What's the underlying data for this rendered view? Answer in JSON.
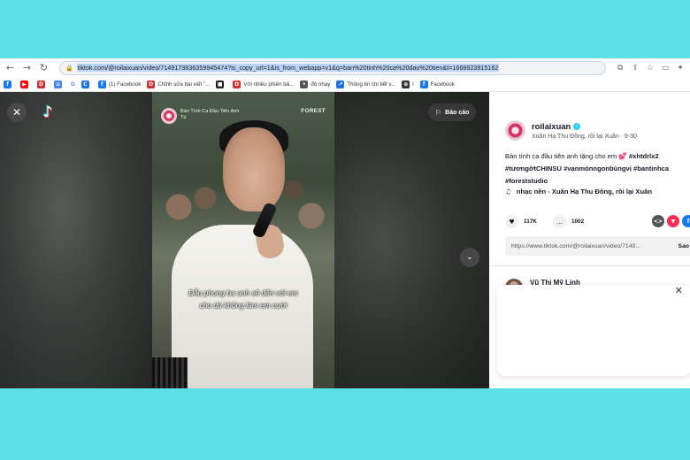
{
  "browser": {
    "url": "tiktok.com/@roilaixuan/video/7149173836359945474?is_copy_url=1&is_from_webapp=v1&q=ban%20tinh%20ca%20dau%20tien&t=1668923915162",
    "nav_icons": [
      "back-arrow",
      "forward-arrow",
      "reload"
    ],
    "bookmarks": [
      {
        "label": "",
        "color": "#1877f2",
        "glyph": "f"
      },
      {
        "label": "",
        "color": "#ff0000",
        "glyph": "▶"
      },
      {
        "label": "",
        "color": "#d32f2f",
        "glyph": "D"
      },
      {
        "label": "",
        "color": "#4285f4",
        "glyph": "≡"
      },
      {
        "label": "G",
        "color": "#ffffff",
        "glyph": ""
      },
      {
        "label": "",
        "color": "#1a73e8",
        "glyph": "C"
      },
      {
        "label": "(1) Facebook",
        "color": "#1877f2",
        "glyph": "f"
      },
      {
        "label": "Chỉnh sửa bài viết \"...",
        "color": "#d32f2f",
        "glyph": "D"
      },
      {
        "label": "",
        "color": "#222222",
        "glyph": "■"
      },
      {
        "label": "Với nhiều phiên bả...",
        "color": "#d32f2f",
        "glyph": "D"
      },
      {
        "label": "độ nhạy",
        "color": "#555555",
        "glyph": "•"
      },
      {
        "label": "Thông tin chi tiết v...",
        "color": "#1a73e8",
        "glyph": "↗"
      },
      {
        "label": "l",
        "color": "#333333",
        "glyph": "⊕"
      },
      {
        "label": "Facebook",
        "color": "#1877f2",
        "glyph": "f"
      }
    ]
  },
  "player": {
    "close_icon": "close-icon",
    "report_label": "Báo cáo",
    "video_title": "Bản Tình Ca Đầu Tiên Anh Tú",
    "video_brand": "FOREST",
    "subtitle_line1": "Dẫu phong ba anh sẽ đến với em",
    "subtitle_line2": "cho dù không làm em cười"
  },
  "sidebar": {
    "username": "roilaixuan",
    "subline": "Xuân Hạ Thu Đông, rồi lại Xuân · 9-30",
    "description": "Bản tình ca đầu tiên anh tặng cho em 💕",
    "hashtags": [
      "#xhtdrlx2",
      "#tươngớtCHINSU",
      "#vạnmónngonbùngvị",
      "#bantinhca",
      "#foreststudio"
    ],
    "music": "nhạc nền - Xuân Hạ Thu Đông, rồi lại Xuân",
    "likes": "117K",
    "comments": "1002",
    "share_link": "https://www.tiktok.com/@roilaixuan/video/7149...",
    "copy_label": "Sao",
    "comment_user": "Vũ Thị Mỹ Linh"
  },
  "colors": {
    "page_background": "#5ddfe6",
    "tiktok_red": "#fe2c55",
    "tiktok_cyan": "#25f4ee"
  }
}
